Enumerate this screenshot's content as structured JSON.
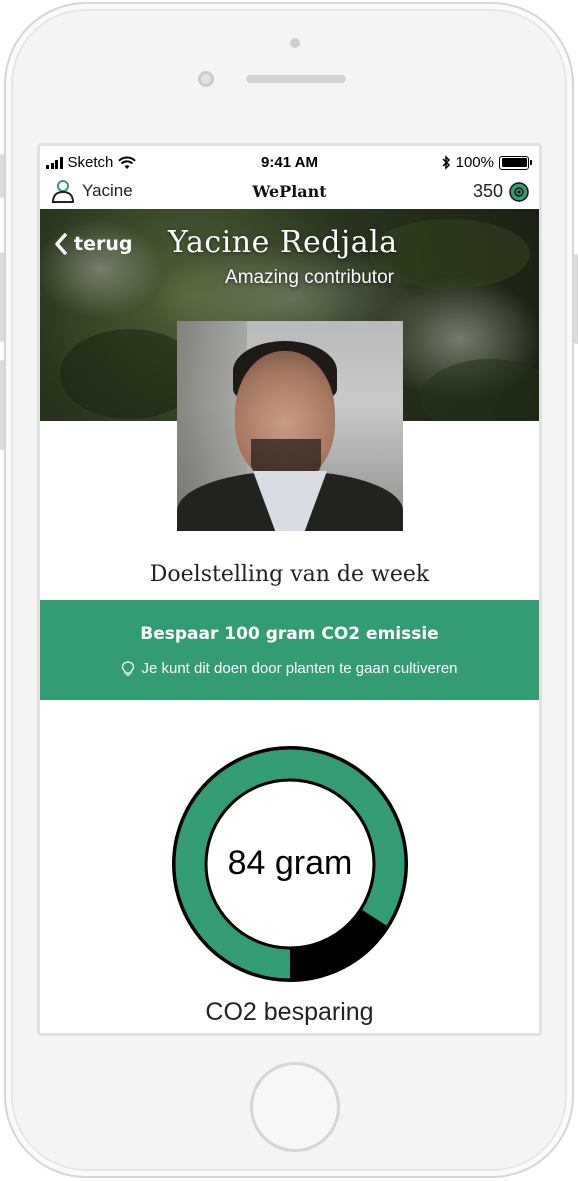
{
  "status_bar": {
    "carrier": "Sketch",
    "time": "9:41 AM",
    "battery": "100%"
  },
  "navbar": {
    "user_name": "Yacine",
    "app_title": "WePlant",
    "points": "350"
  },
  "profile": {
    "back_label": "terug",
    "name": "Yacine Redjala",
    "subtitle": "Amazing contributor"
  },
  "goal": {
    "heading": "Doelstelling van de week",
    "main": "Bespaar 100 gram CO2 emissie",
    "tip": "Je kunt dit doen door planten te gaan cultiveren"
  },
  "progress": {
    "value_text": "84 gram",
    "label": "CO2 besparing",
    "current": 84,
    "target": 100
  },
  "colors": {
    "accent": "#339c73",
    "ring_remaining": "#000000"
  },
  "icons": {
    "user": "user-icon",
    "points": "coin-icon",
    "back": "chevron-left-icon",
    "tip": "lightbulb-icon"
  }
}
